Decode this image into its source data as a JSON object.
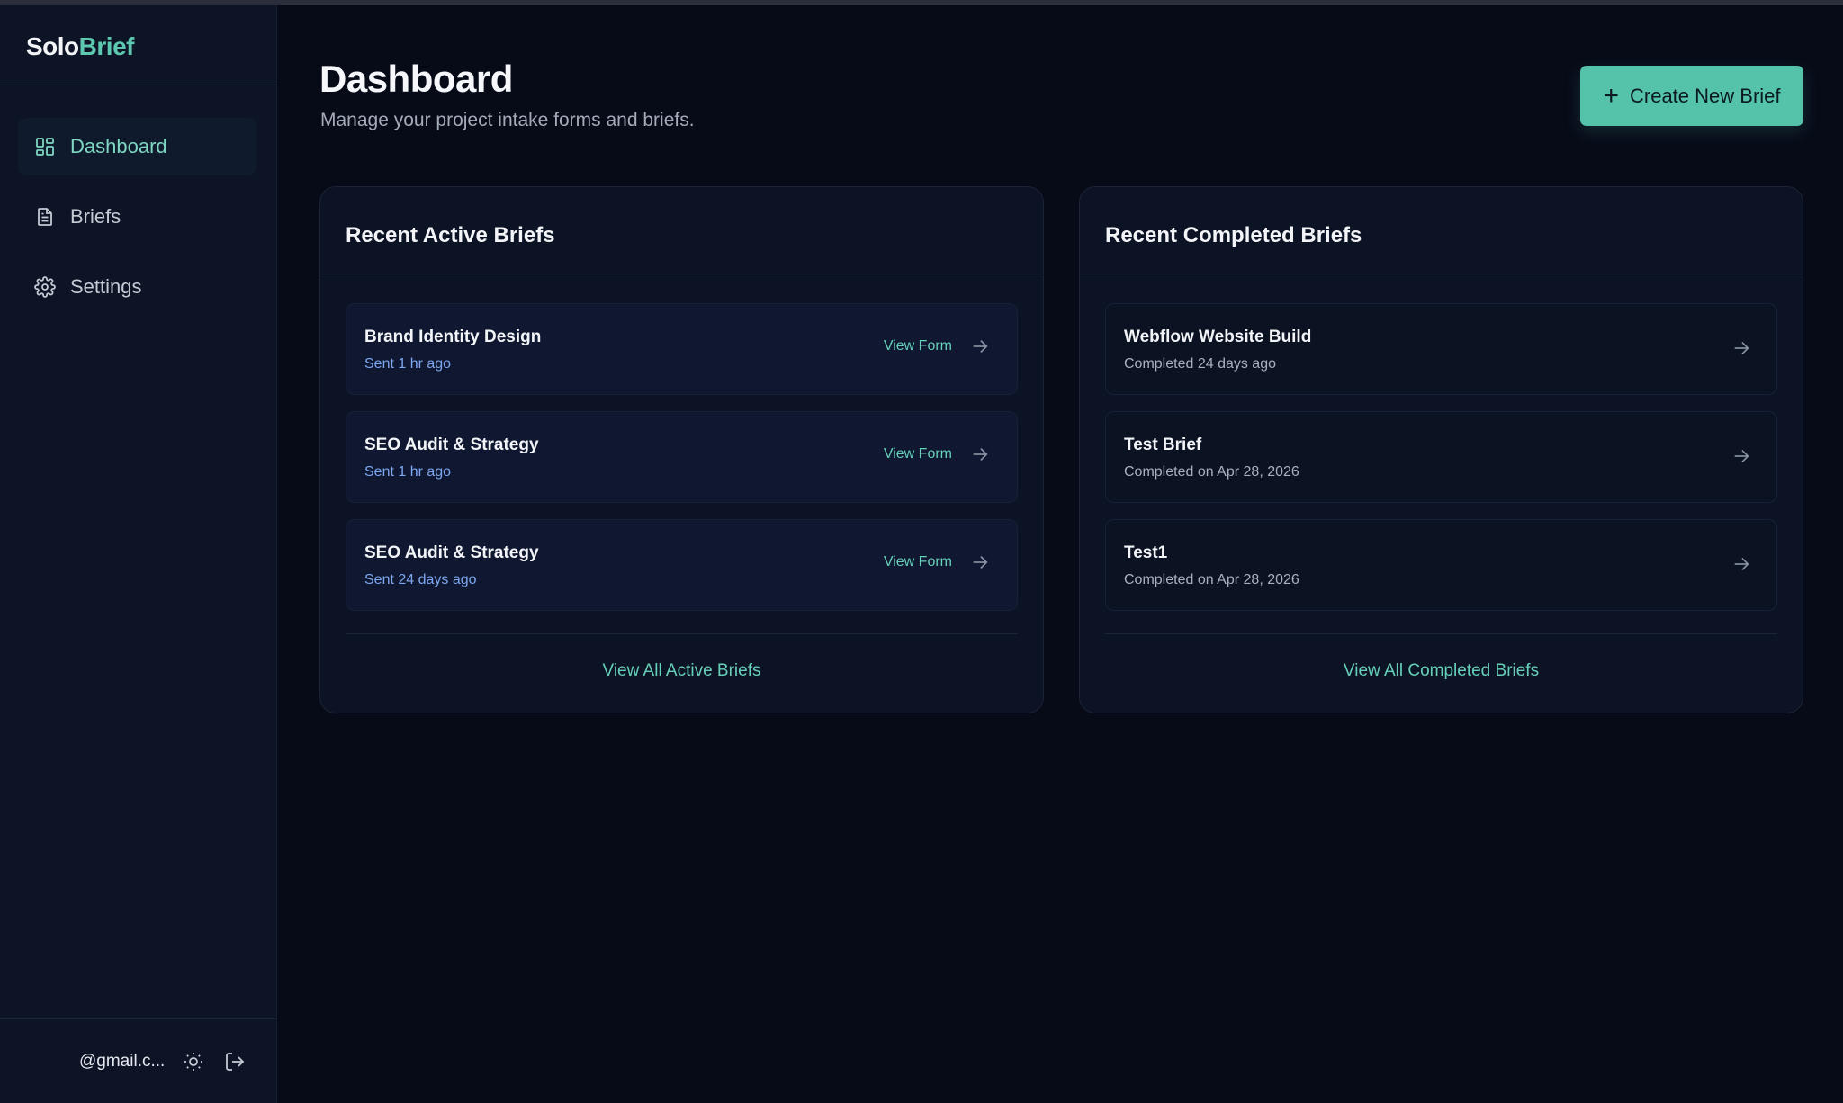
{
  "app": {
    "logo_part1": "Solo",
    "logo_part2": "Brief"
  },
  "sidebar": {
    "items": [
      {
        "label": "Dashboard",
        "icon": "dashboard-icon",
        "active": true
      },
      {
        "label": "Briefs",
        "icon": "document-icon",
        "active": false
      },
      {
        "label": "Settings",
        "icon": "gear-icon",
        "active": false
      }
    ],
    "footer": {
      "email": "@gmail.c...",
      "theme_icon": "sun-icon",
      "logout_icon": "logout-icon"
    }
  },
  "header": {
    "title": "Dashboard",
    "subtitle": "Manage your project intake forms and briefs.",
    "create_button": "Create New Brief"
  },
  "active_briefs": {
    "title": "Recent Active Briefs",
    "items": [
      {
        "title": "Brand Identity Design",
        "status": "Sent 1 hr ago",
        "action": "View Form"
      },
      {
        "title": "SEO Audit & Strategy",
        "status": "Sent 1 hr ago",
        "action": "View Form"
      },
      {
        "title": "SEO Audit & Strategy",
        "status": "Sent 24 days ago",
        "action": "View Form"
      }
    ],
    "view_all": "View All Active Briefs"
  },
  "completed_briefs": {
    "title": "Recent Completed Briefs",
    "items": [
      {
        "title": "Webflow Website Build",
        "status": "Completed 24 days ago"
      },
      {
        "title": "Test Brief",
        "status": "Completed on Apr 28, 2026"
      },
      {
        "title": "Test1",
        "status": "Completed on Apr 28, 2026"
      }
    ],
    "view_all": "View All Completed Briefs"
  },
  "colors": {
    "accent": "#55c2aa",
    "background": "#070b18",
    "sidebar": "#0d1426",
    "link": "#66cfb8",
    "sent_status": "#7da7f0"
  }
}
